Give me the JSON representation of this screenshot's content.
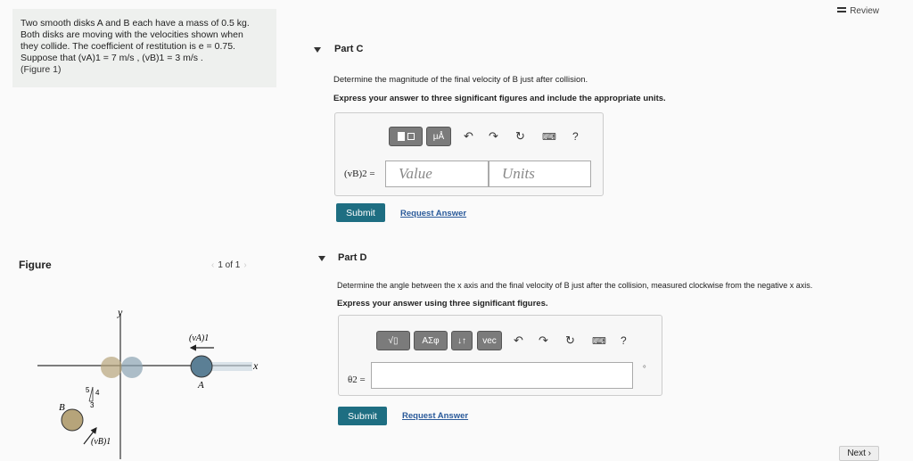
{
  "problem": {
    "lines": [
      "Two smooth disks A and B each have a mass of 0.5 kg.",
      "Both disks are moving with the velocities shown when",
      "they collide. The coefficient of restitution is e = 0.75.",
      "Suppose that (vA)1 = 7 m/s , (vB)1 = 3 m/s ."
    ],
    "figure_link": "(Figure 1)"
  },
  "review": "Review",
  "part_c": {
    "title": "Part C",
    "question": "Determine the magnitude of the final velocity of B just after collision.",
    "instruction": "Express your answer to three significant figures and include the appropriate units.",
    "var_label": "(vB)2 =",
    "value_placeholder": "Value",
    "units_placeholder": "Units",
    "mu_label": "μÅ",
    "help": "?",
    "submit": "Submit",
    "request": "Request Answer"
  },
  "part_d": {
    "title": "Part D",
    "question": "Determine the angle between the x axis and the final velocity of B just after the collision, measured clockwise from the negative x axis.",
    "instruction": "Express your answer using three significant figures.",
    "var_label": "θ2 =",
    "unit": "°",
    "sqrt_label": "√▯",
    "greek_label": "ΑΣφ",
    "swap_label": "↓↑",
    "vec_label": "vec",
    "help": "?",
    "submit": "Submit",
    "request": "Request Answer"
  },
  "figure": {
    "title": "Figure",
    "pager": "1 of 1",
    "y_axis": "y",
    "x_axis": "x",
    "label_a": "A",
    "label_b": "B",
    "va": "(vA)1",
    "vb": "(vB)1",
    "slope_5": "5",
    "slope_4": "4",
    "slope_3": "3"
  },
  "next": "Next ›",
  "colors": {
    "submit": "#1e6e82",
    "disk_a": "#5b7f95",
    "disk_b": "#b6a47a",
    "toolbar": "#7b7b7b"
  }
}
